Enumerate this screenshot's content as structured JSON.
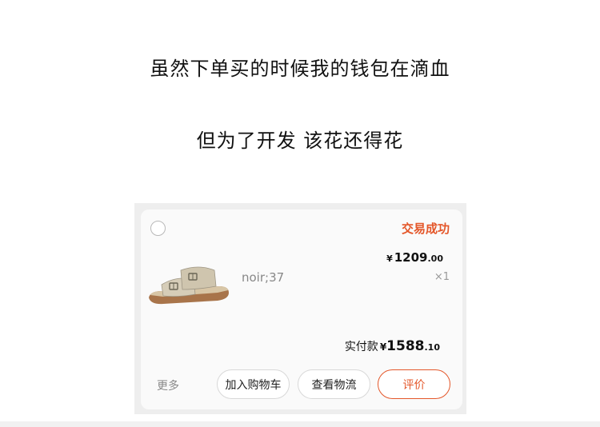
{
  "captions": {
    "line1": "虽然下单买的时候我的钱包在滴血",
    "line2": "但为了开发 该花还得花"
  },
  "order_card": {
    "status": "交易成功",
    "item": {
      "image_icon": "sandal-product-image",
      "sku": "noir;37",
      "price_symbol": "¥",
      "price_int": "1209",
      "price_dec": ".00",
      "quantity": "×1"
    },
    "paid": {
      "label": "实付款",
      "symbol": "¥",
      "amount_int": "1588",
      "amount_dec": ".10"
    },
    "actions": {
      "more": "更多",
      "add_to_cart": "加入购物车",
      "view_logistics": "查看物流",
      "review": "评价"
    }
  },
  "colors": {
    "accent": "#e4572a",
    "card_bg": "#fafafa",
    "frame_bg": "#eeeeee"
  }
}
